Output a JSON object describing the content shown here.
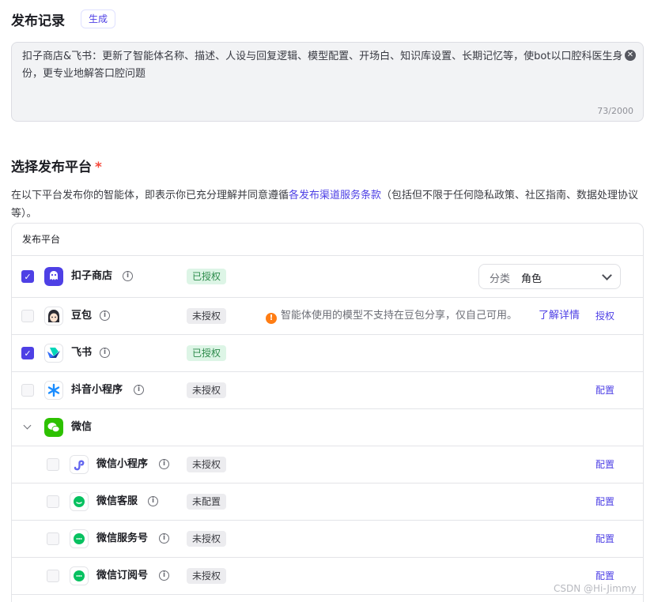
{
  "release": {
    "title": "发布记录",
    "generate_label": "生成",
    "description": "扣子商店&飞书：更新了智能体名称、描述、人设与回复逻辑、模型配置、开场白、知识库设置、长期记忆等，使bot以口腔科医生身份，更专业地解答口腔问题",
    "counter": "73/2000"
  },
  "platform": {
    "title": "选择发布平台",
    "required_mark": "*",
    "agreement_before": "在以下平台发布你的智能体，即表示你已充分理解并同意遵循",
    "agreement_link": "各发布渠道服务条款",
    "agreement_after": "（包括但不限于任何隐私政策、社区指南、数据处理协议等）。",
    "table_header": "发布平台",
    "rows": [
      {
        "name": "扣子商店",
        "badge": "已授权",
        "checked": true,
        "category_label": "分类",
        "category_value": "角色"
      },
      {
        "name": "豆包",
        "badge": "未授权",
        "checked": false,
        "warning": "智能体使用的模型不支持在豆包分享，仅自己可用。",
        "warning_link": "了解详情",
        "action": "授权"
      },
      {
        "name": "飞书",
        "badge": "已授权",
        "checked": true
      },
      {
        "name": "抖音小程序",
        "badge": "未授权",
        "checked": false,
        "action": "配置"
      },
      {
        "name": "微信"
      },
      {
        "name": "微信小程序",
        "badge": "未授权",
        "checked": false,
        "action": "配置"
      },
      {
        "name": "微信客服",
        "badge": "未配置",
        "checked": false,
        "action": "配置"
      },
      {
        "name": "微信服务号",
        "badge": "未授权",
        "checked": false,
        "action": "配置"
      },
      {
        "name": "微信订阅号",
        "badge": "未授权",
        "checked": false,
        "action": "配置"
      }
    ]
  },
  "watermark": "CSDN @Hi-Jimmy",
  "colors": {
    "accent": "#4e40e5",
    "warning": "#ff7d14",
    "authorized": "#2c8a4a"
  }
}
